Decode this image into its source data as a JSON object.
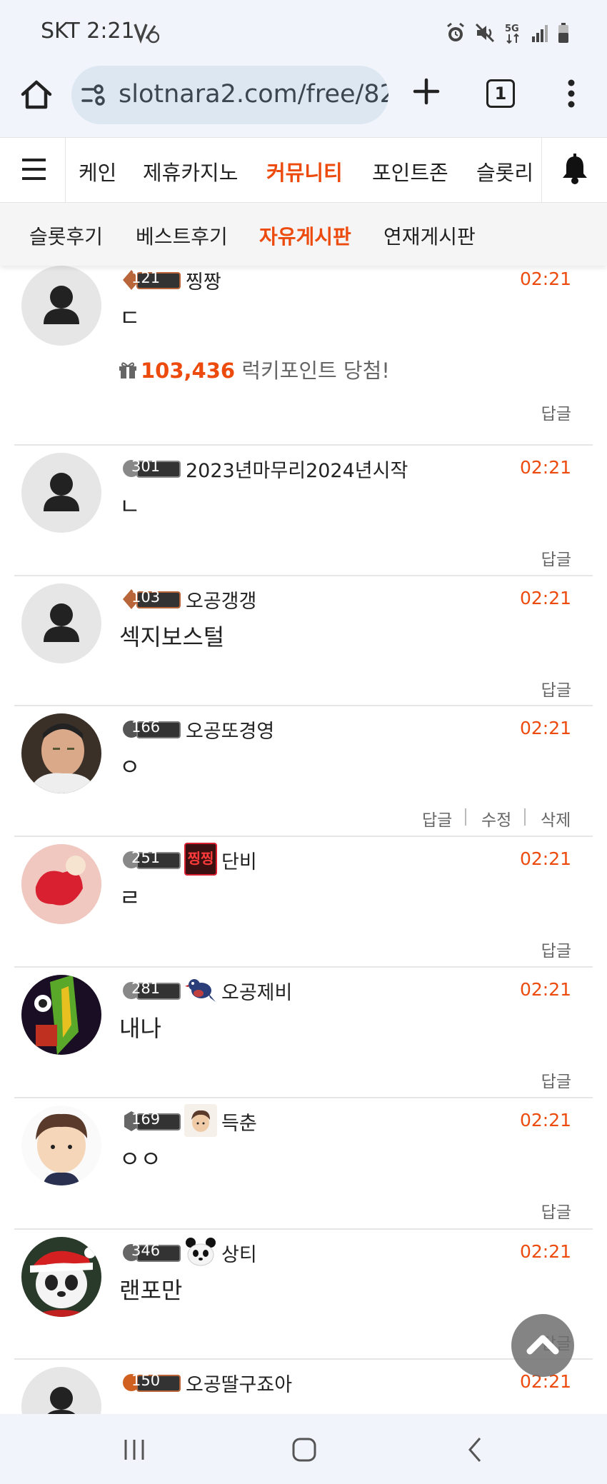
{
  "status_bar": {
    "time": "SKT 2:21"
  },
  "browser": {
    "url": "slotnara2.com/free/82",
    "tab_count": "1"
  },
  "site_nav": {
    "items": [
      "케인",
      "제휴카지노",
      "커뮤니티",
      "포인트존",
      "슬롯리"
    ],
    "active": "커뮤니티"
  },
  "sub_nav": {
    "items": [
      "슬롯후기",
      "베스트후기",
      "자유게시판",
      "연재게시판"
    ],
    "active": "자유게시판"
  },
  "comments": [
    {
      "level": "121",
      "nick": "찡짱",
      "time": "02:21",
      "text": "ㄷ",
      "lucky_points": "103,436",
      "lucky_text": "럭키포인트 당첨!",
      "reply": "답글"
    },
    {
      "level": "301",
      "nick": "2023년마무리2024년시작",
      "time": "02:21",
      "text": "ㄴ",
      "reply": "답글"
    },
    {
      "level": "103",
      "nick": "오공갱갱",
      "time": "02:21",
      "text": "섹지보스털",
      "reply": "답글"
    },
    {
      "level": "166",
      "nick": "오공또경영",
      "time": "02:21",
      "text": "ㅇ",
      "reply": "답글",
      "edit": "수정",
      "delete": "삭제"
    },
    {
      "level": "251",
      "nick": "단비",
      "time": "02:21",
      "text": "ㄹ",
      "reply": "답글",
      "badge_text": "찡찡"
    },
    {
      "level": "281",
      "nick": "오공제비",
      "time": "02:21",
      "text": "내나",
      "reply": "답글"
    },
    {
      "level": "169",
      "nick": "득춘",
      "time": "02:21",
      "text": "ㅇㅇ",
      "reply": "답글"
    },
    {
      "level": "346",
      "nick": "상티",
      "time": "02:21",
      "text": "랜포만",
      "reply": "답글"
    },
    {
      "level": "150",
      "nick": "오공딸구죠아",
      "time": "02:21"
    }
  ],
  "colors": {
    "accent": "#ec4b0d",
    "browser_chrome": "#f1f4fa",
    "url_bar": "#dde7f1"
  }
}
